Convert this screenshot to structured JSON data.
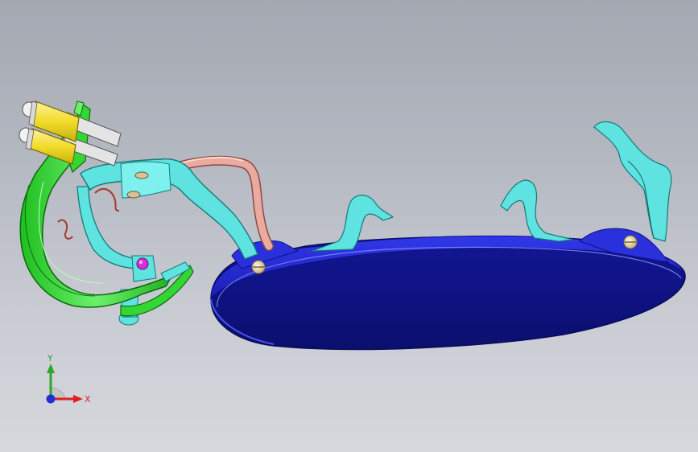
{
  "triad": {
    "x_label": "X",
    "y_label": "Y",
    "colors": {
      "x": "#e0201e",
      "y": "#2aa82a",
      "z": "#1f2fd6"
    }
  },
  "model": {
    "parts": [
      "plate-icon",
      "bracket-icon",
      "arm-icon",
      "tube-icon",
      "clip-icon",
      "pin-icon",
      "screw-icon"
    ],
    "colors": {
      "plate": "#1c22c6",
      "bracket": "#55e0df",
      "arm": "#2edb2e",
      "tube": "#eaaaa0",
      "connector": "#f5e43a",
      "pin": "#e8e8e8",
      "screw": "#e8d6a4",
      "accent": "#d42fd4"
    }
  }
}
